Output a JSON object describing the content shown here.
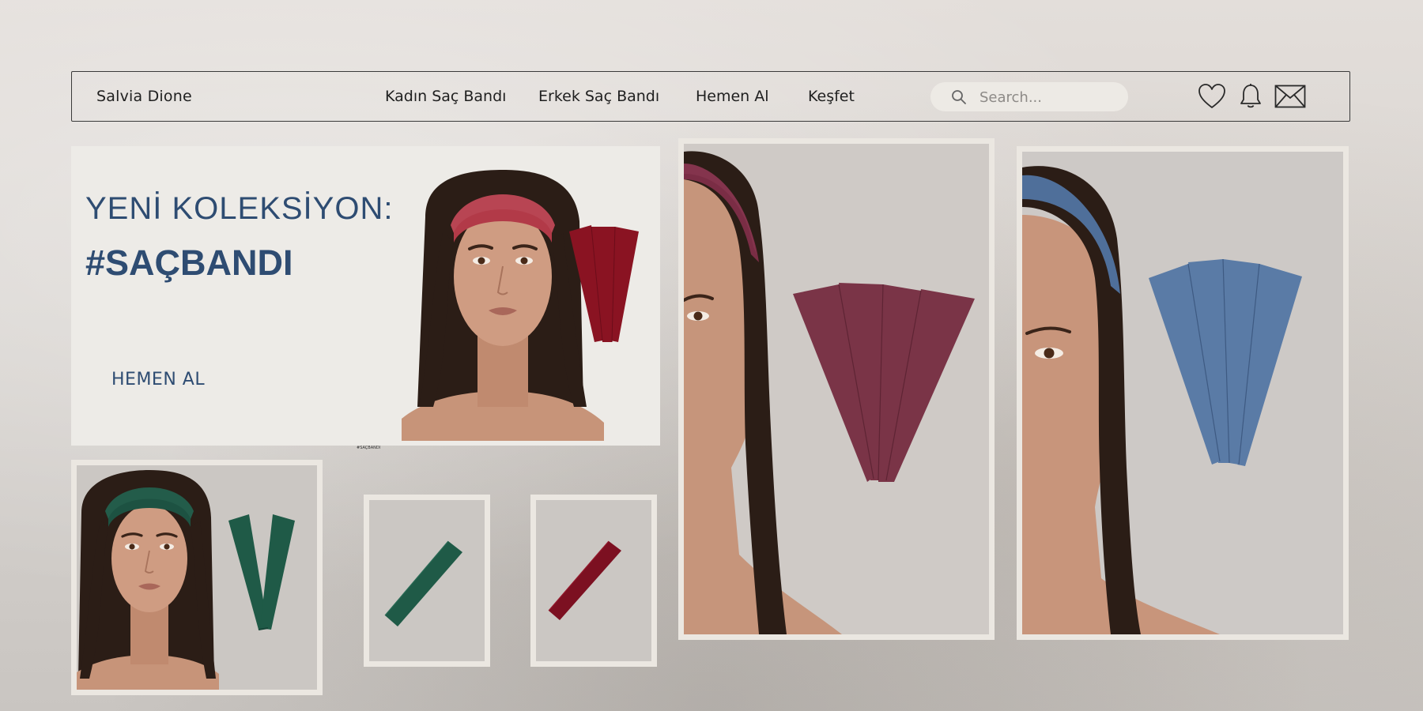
{
  "header": {
    "brand": "Salvia Dione",
    "nav": [
      "Kadın Saç Bandı",
      "Erkek Saç Bandı",
      "Hemen Al",
      "Keşfet"
    ],
    "search_placeholder": "Search...",
    "icons": [
      "search-icon",
      "heart-icon",
      "bell-icon",
      "mail-icon"
    ]
  },
  "hero": {
    "title": "YENİ KOLEKSİYON:",
    "hashtag": "#SAÇBANDI",
    "cta": "HEMEN AL",
    "caption": "#SAÇBANDI"
  },
  "products": [
    {
      "color_name": "burgundy",
      "color": "#7c1021"
    },
    {
      "color_name": "plum",
      "color": "#7a3447"
    },
    {
      "color_name": "denim-blue",
      "color": "#4f6f9a"
    },
    {
      "color_name": "forest-green",
      "color": "#1d5242"
    }
  ],
  "colors": {
    "accent": "#2e4c72",
    "card_border": "#ebe7e1",
    "hero_bg": "#edebe7"
  }
}
